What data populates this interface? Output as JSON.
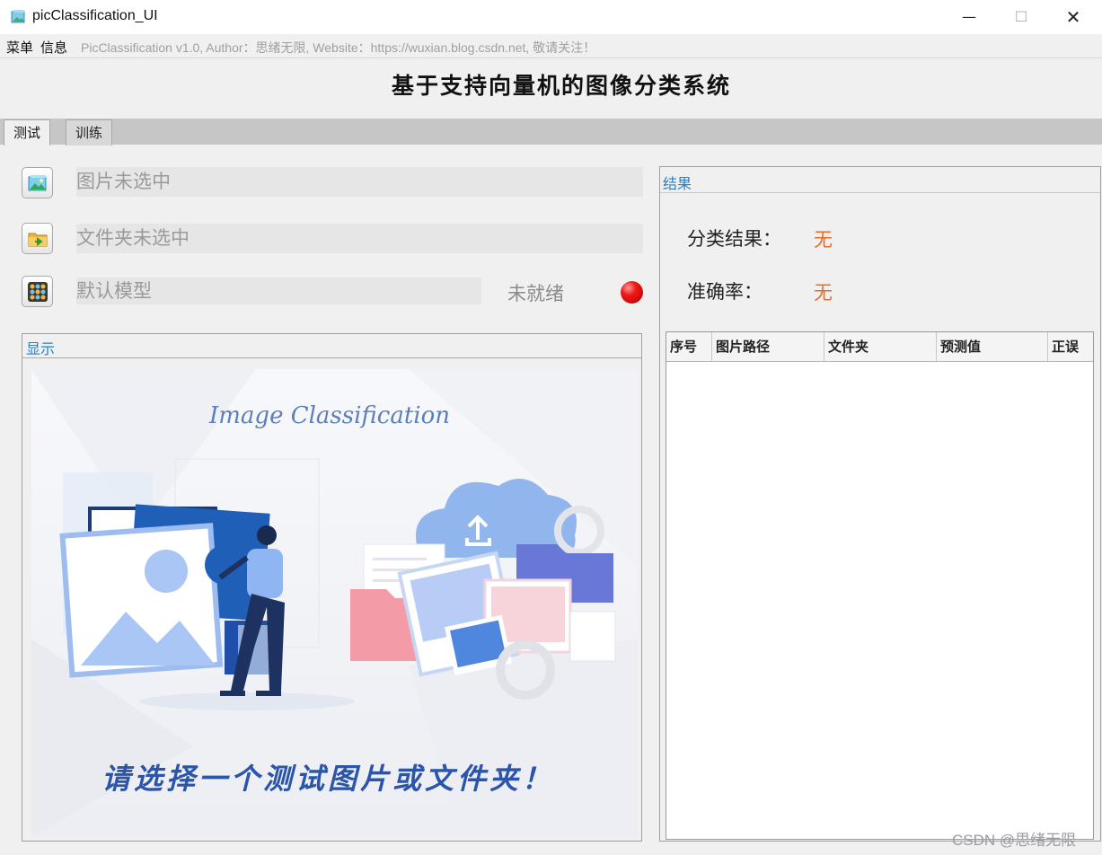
{
  "window": {
    "title": "picClassification_UI",
    "minimize": "—",
    "maximize": "☐",
    "close": "✕"
  },
  "menubar": {
    "items": [
      "菜单",
      "信息"
    ],
    "info_text": "PicClassification v1.0, Author：思绪无限, Website：https://wuxian.blog.csdn.net, 敬请关注！"
  },
  "header": {
    "title": "基于支持向量机的图像分类系统"
  },
  "tabs": [
    {
      "label": "测试",
      "selected": true
    },
    {
      "label": "训练",
      "selected": false
    }
  ],
  "inputs": {
    "picture_field": "图片未选中",
    "folder_field": "文件夹未选中",
    "model_field": "默认模型",
    "model_status": "未就绪",
    "status_color": "#e01010"
  },
  "display": {
    "group_title": "显示",
    "image_title": "Image Classification",
    "image_caption": "请选择一个测试图片或文件夹！"
  },
  "result": {
    "group_title": "结果",
    "class_label": "分类结果：",
    "class_value": "无",
    "accuracy_label": "准确率：",
    "accuracy_value": "无",
    "value_color": "#ee6a22",
    "table": {
      "columns": [
        "序号",
        "图片路径",
        "文件夹",
        "预测值",
        "正误"
      ],
      "rows": []
    }
  },
  "watermark": "CSDN @思绪无限"
}
